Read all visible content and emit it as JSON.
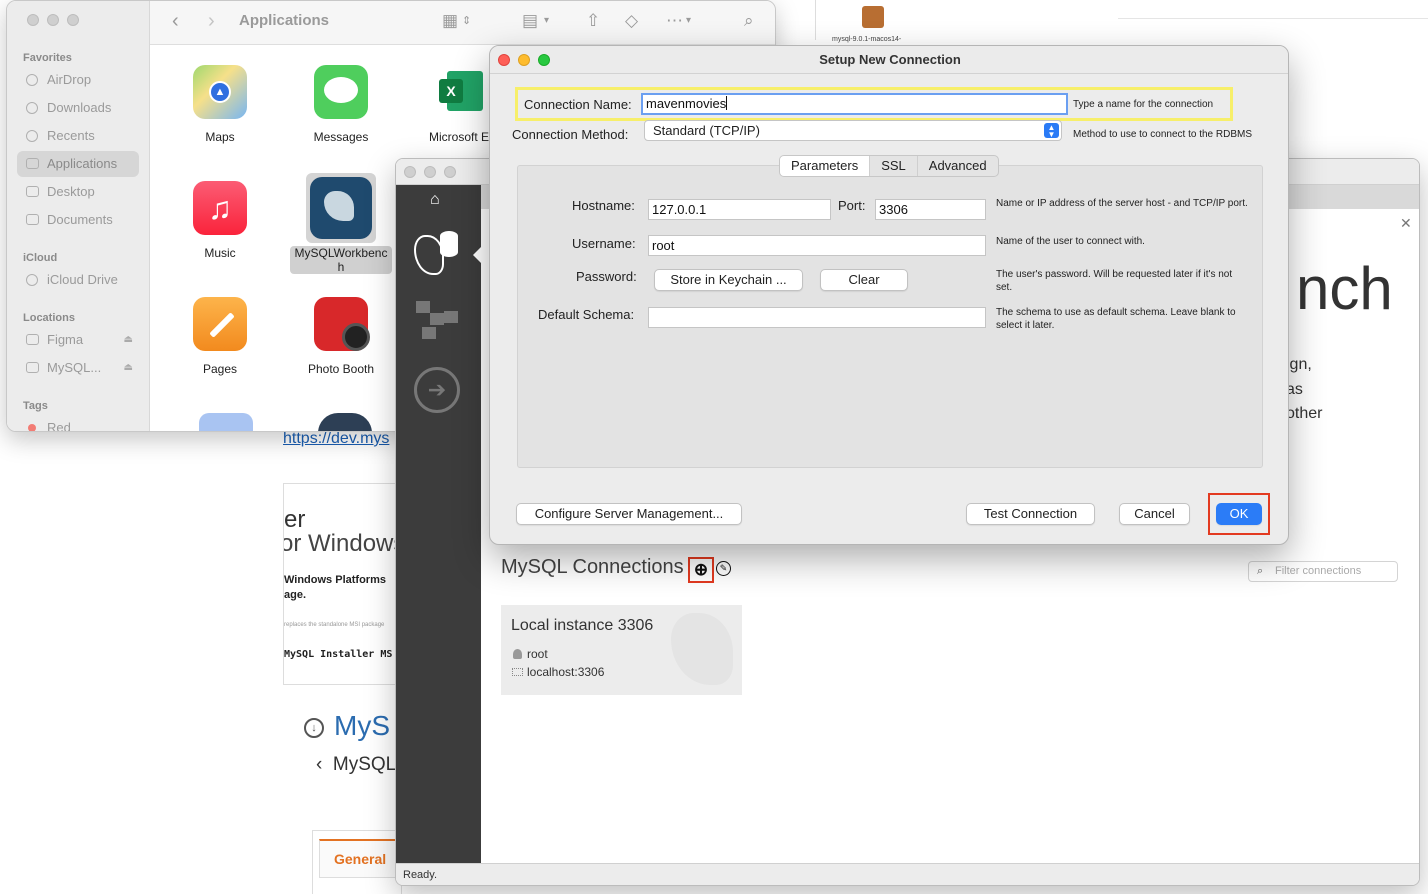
{
  "background_page": {
    "link_text": "https://dev.mys",
    "card": {
      "heading_line1": "er",
      "heading_line2": "or Windows",
      "bold_line1": "Windows Platforms",
      "bold_line2": "age.",
      "tiny_text": "replaces the standalone MSI package",
      "installer_text": "MySQL Installer MS"
    },
    "section_heading": "MyS",
    "section_sub": "MySQL",
    "tab_general": "General",
    "package_label": "mysql-9.0.1-macos14-"
  },
  "finder": {
    "toolbar_title": "Applications",
    "sidebar": {
      "favorites_header": "Favorites",
      "favorites": [
        {
          "label": "AirDrop",
          "icon": "airdrop-icon"
        },
        {
          "label": "Downloads",
          "icon": "downloads-icon"
        },
        {
          "label": "Recents",
          "icon": "clock-icon"
        },
        {
          "label": "Applications",
          "icon": "applications-icon"
        },
        {
          "label": "Desktop",
          "icon": "desktop-icon"
        },
        {
          "label": "Documents",
          "icon": "document-icon"
        }
      ],
      "icloud_header": "iCloud",
      "icloud_drive": "iCloud Drive",
      "locations_header": "Locations",
      "locations": [
        "Figma",
        "MySQL..."
      ],
      "tags_header": "Tags",
      "tag_red": "Red"
    },
    "apps": [
      {
        "label": "Maps"
      },
      {
        "label": "Messages"
      },
      {
        "label": "Microsoft Ex"
      },
      {
        "label": "Music"
      },
      {
        "label": "MySQLWorkbench"
      },
      {
        "label": "Pages"
      },
      {
        "label": "Photo Booth"
      }
    ]
  },
  "workbench": {
    "hero_text": "nch",
    "side_lines": [
      "ign,",
      "as",
      "other"
    ],
    "connections_title": "MySQL Connections",
    "filter_placeholder": "Filter connections",
    "tile": {
      "title": "Local instance 3306",
      "user": "root",
      "host": "localhost:3306"
    },
    "status": "Ready."
  },
  "dialog": {
    "title": "Setup New Connection",
    "connection_name_label": "Connection Name:",
    "connection_name_value": "mavenmovies",
    "connection_name_help": "Type a name for the connection",
    "connection_method_label": "Connection Method:",
    "connection_method_value": "Standard (TCP/IP)",
    "connection_method_help": "Method to use to connect to the RDBMS",
    "tabs": [
      "Parameters",
      "SSL",
      "Advanced"
    ],
    "active_tab": "Parameters",
    "hostname_label": "Hostname:",
    "hostname_value": "127.0.0.1",
    "port_label": "Port:",
    "port_value": "3306",
    "hostname_help": "Name or IP address of the server host - and TCP/IP port.",
    "username_label": "Username:",
    "username_value": "root",
    "username_help": "Name of the user to connect with.",
    "password_label": "Password:",
    "store_keychain_button": "Store in Keychain ...",
    "clear_button": "Clear",
    "password_help": "The user's password. Will be requested later if it's not set.",
    "default_schema_label": "Default Schema:",
    "default_schema_value": "",
    "default_schema_help": "The schema to use as default schema. Leave blank to select it later.",
    "configure_button": "Configure Server Management...",
    "test_button": "Test Connection",
    "cancel_button": "Cancel",
    "ok_button": "OK"
  },
  "colors": {
    "accent_blue": "#2b7cf7",
    "highlight_red": "#e33a20",
    "highlight_yellow": "#f7ef6a"
  }
}
